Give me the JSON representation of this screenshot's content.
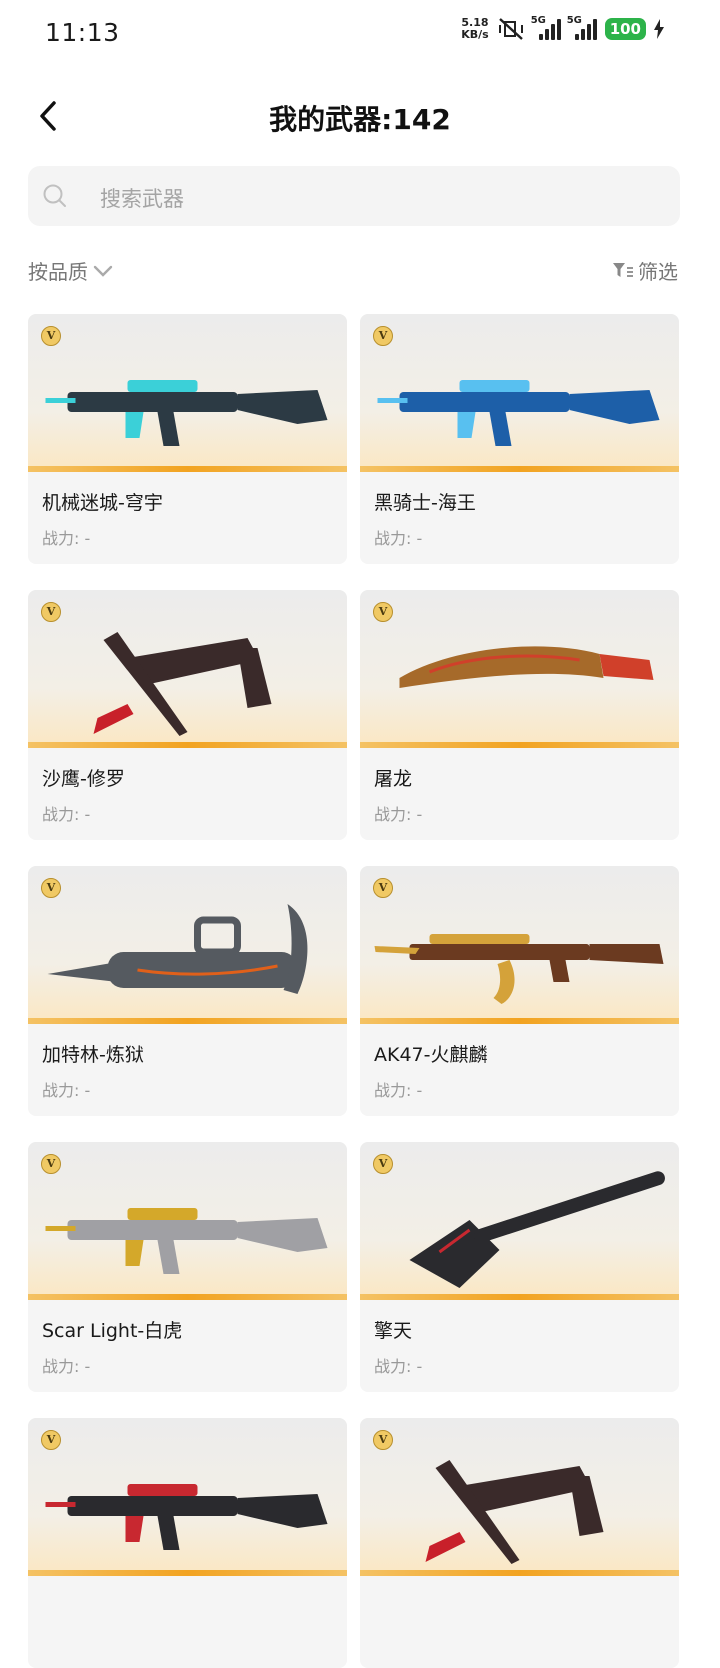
{
  "status_bar": {
    "time": "11:13",
    "speed_value": "5.18",
    "speed_unit": "KB/s",
    "net1": "5G",
    "net2": "5G",
    "battery": "100"
  },
  "header": {
    "title": "我的武器:142"
  },
  "search": {
    "placeholder": "搜索武器"
  },
  "toolbar": {
    "sort_label": "按品质",
    "filter_label": "筛选"
  },
  "badge_letter": "V",
  "weapons": [
    {
      "name": "机械迷城-穹宇",
      "power": "战力: -",
      "icon": "rifle-icon",
      "color": "#2c3a44",
      "accent": "#3bd0d8"
    },
    {
      "name": "黑骑士-海王",
      "power": "战力: -",
      "icon": "rifle-icon",
      "color": "#1d5fa8",
      "accent": "#58c0f0"
    },
    {
      "name": "沙鹰-修罗",
      "power": "战力: -",
      "icon": "pistol-blade-icon",
      "color": "#3a2a2a",
      "accent": "#c8202a"
    },
    {
      "name": "屠龙",
      "power": "战力: -",
      "icon": "machete-icon",
      "color": "#a66a2a",
      "accent": "#d0402a"
    },
    {
      "name": "加特林-炼狱",
      "power": "战力: -",
      "icon": "gatling-icon",
      "color": "#555a60",
      "accent": "#e0601a"
    },
    {
      "name": "AK47-火麒麟",
      "power": "战力: -",
      "icon": "ak-rifle-icon",
      "color": "#6b3a20",
      "accent": "#d4a23a"
    },
    {
      "name": "Scar Light-白虎",
      "power": "战力: -",
      "icon": "rifle-icon",
      "color": "#a0a0a4",
      "accent": "#d4a82a"
    },
    {
      "name": "擎天",
      "power": "战力: -",
      "icon": "shovel-icon",
      "color": "#2a2a2e",
      "accent": "#c82830"
    },
    {
      "name": "",
      "power": "",
      "icon": "rifle-icon",
      "color": "#2a2a2e",
      "accent": "#c82830"
    },
    {
      "name": "",
      "power": "",
      "icon": "pistol-blade-icon",
      "color": "#3a2a2a",
      "accent": "#c8202a"
    }
  ]
}
